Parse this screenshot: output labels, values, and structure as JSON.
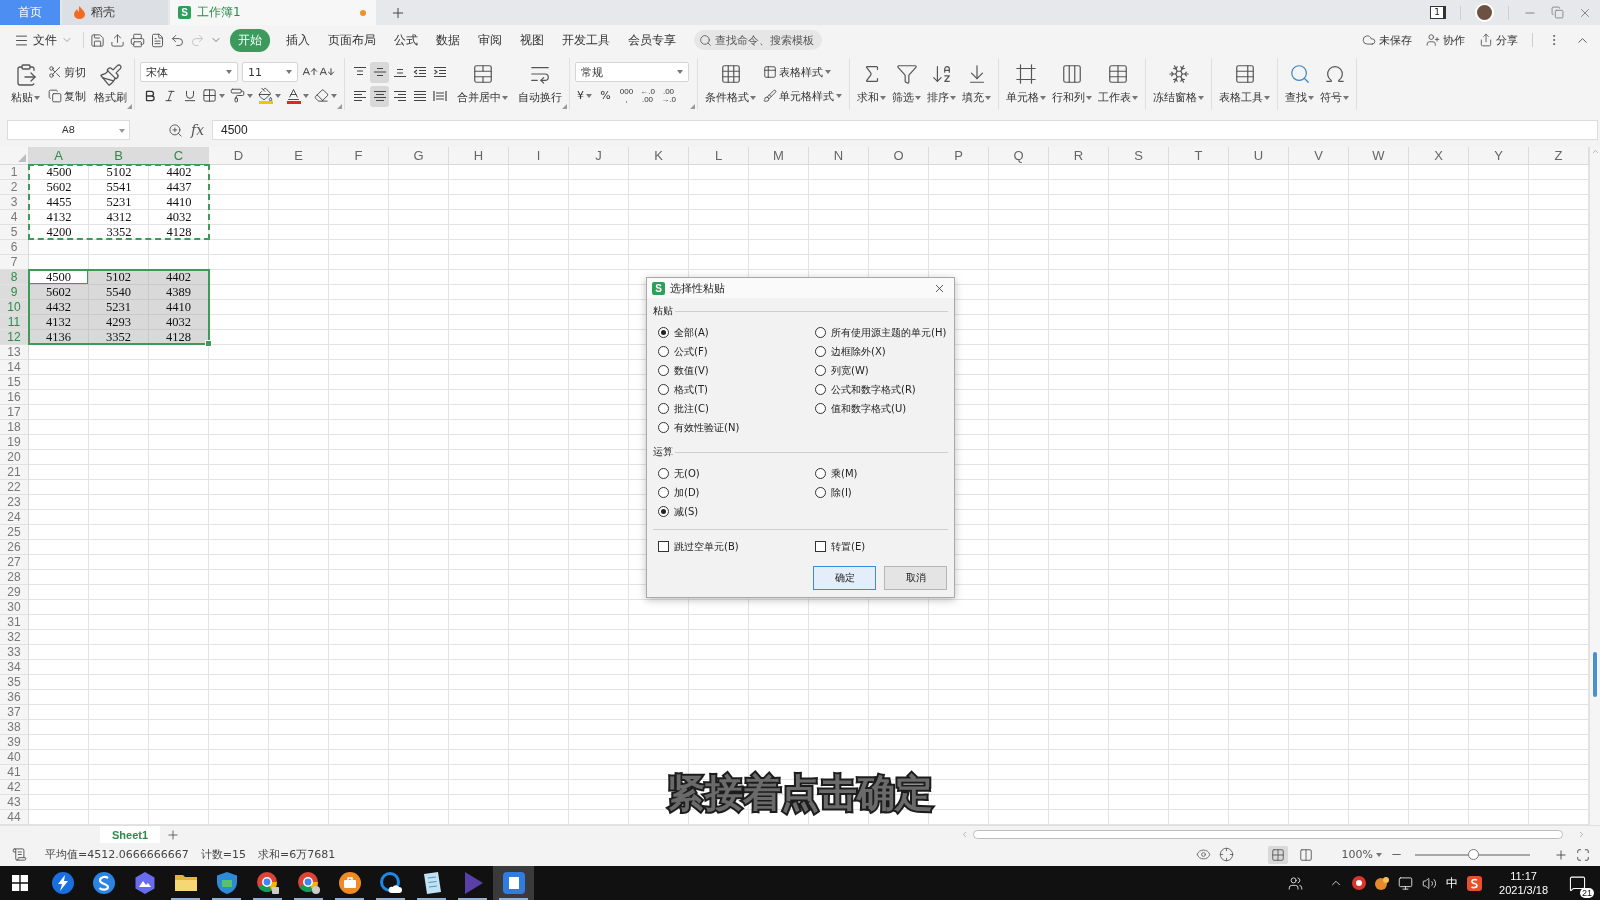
{
  "title_bar": {
    "tabs": [
      {
        "kind": "home",
        "label": "首页",
        "selected": false
      },
      {
        "kind": "docer",
        "label": "稻壳",
        "selected": false
      },
      {
        "kind": "workbook",
        "logo": "S",
        "label": "工作簿1",
        "selected": true,
        "unsaved": true
      }
    ],
    "window_count": "1"
  },
  "menu_bar": {
    "file": "文件",
    "quick_access": [
      {
        "kind": "save",
        "disabled": false
      },
      {
        "kind": "export",
        "disabled": false
      },
      {
        "kind": "print",
        "disabled": false
      },
      {
        "kind": "preview",
        "disabled": false
      },
      {
        "kind": "undo",
        "disabled": false
      },
      {
        "kind": "redo",
        "disabled": true
      },
      {
        "kind": "customize",
        "disabled": false
      }
    ],
    "tabs": [
      {
        "label": "开始",
        "selected": true
      },
      {
        "label": "插入",
        "selected": false
      },
      {
        "label": "页面布局",
        "selected": false
      },
      {
        "label": "公式",
        "selected": false
      },
      {
        "label": "数据",
        "selected": false
      },
      {
        "label": "审阅",
        "selected": false
      },
      {
        "label": "视图",
        "selected": false
      },
      {
        "label": "开发工具",
        "selected": false
      },
      {
        "label": "会员专享",
        "selected": false
      }
    ],
    "search": {
      "placeholder": "查找命令、搜索模板"
    },
    "actions": [
      {
        "kind": "cloud",
        "label": "未保存"
      },
      {
        "kind": "collaborate",
        "label": "协作"
      },
      {
        "kind": "share",
        "label": "分享"
      }
    ]
  },
  "ribbon": {
    "clipboard": {
      "paste": "粘贴",
      "cut": "剪切",
      "copy": "复制",
      "format_painter": "格式刷"
    },
    "font": {
      "name": "宋体",
      "size": "11"
    },
    "alignment": {
      "vertical": [
        {
          "kind": "top",
          "selected": false
        },
        {
          "kind": "middle",
          "selected": true
        },
        {
          "kind": "bottom",
          "selected": false
        }
      ],
      "horizontal": [
        {
          "kind": "left",
          "selected": false
        },
        {
          "kind": "center",
          "selected": true
        },
        {
          "kind": "right",
          "selected": false
        },
        {
          "kind": "justify",
          "selected": false
        },
        {
          "kind": "distributed",
          "selected": false
        }
      ],
      "merge": "合并居中",
      "wrap": "自动换行"
    },
    "number": {
      "format": "常规",
      "buttons": [
        {
          "kind": "currency",
          "lines": [
            "¥"
          ]
        },
        {
          "kind": "percent",
          "lines": [
            "%"
          ]
        },
        {
          "kind": "thousands",
          "lines": [
            "000",
            ","
          ]
        },
        {
          "kind": "add_decimal",
          "lines": [
            "←.0",
            ".00"
          ]
        },
        {
          "kind": "remove_decimal",
          "lines": [
            ".00",
            "→.0"
          ]
        }
      ]
    },
    "styles": {
      "conditional": "条件格式",
      "table_style": "表格样式",
      "cell_style": "单元格样式"
    },
    "tool_groups": [
      {
        "tools": [
          {
            "kind": "sum",
            "label": "求和"
          },
          {
            "kind": "filter",
            "label": "筛选"
          },
          {
            "kind": "sort",
            "label": "排序"
          },
          {
            "kind": "fill",
            "label": "填充"
          }
        ]
      },
      {
        "tools": [
          {
            "kind": "cell",
            "label": "单元格"
          },
          {
            "kind": "row_col",
            "label": "行和列"
          },
          {
            "kind": "worksheet",
            "label": "工作表"
          }
        ]
      },
      {
        "tools": [
          {
            "kind": "freeze",
            "label": "冻结窗格"
          }
        ]
      },
      {
        "tools": [
          {
            "kind": "table_tools",
            "label": "表格工具"
          }
        ]
      },
      {
        "tools": [
          {
            "kind": "find",
            "label": "查找"
          },
          {
            "kind": "symbol",
            "label": "符号"
          }
        ]
      }
    ]
  },
  "formula_bar": {
    "name_box": "A8",
    "fx": "fx",
    "formula": "4500"
  },
  "sheet": {
    "columns": [
      {
        "label": "A",
        "selected": true
      },
      {
        "label": "B",
        "selected": true
      },
      {
        "label": "C",
        "selected": true
      },
      {
        "label": "D",
        "selected": false
      },
      {
        "label": "E",
        "selected": false
      },
      {
        "label": "F",
        "selected": false
      },
      {
        "label": "G",
        "selected": false
      },
      {
        "label": "H",
        "selected": false
      },
      {
        "label": "I",
        "selected": false
      },
      {
        "label": "J",
        "selected": false
      },
      {
        "label": "K",
        "selected": false
      },
      {
        "label": "L",
        "selected": false
      },
      {
        "label": "M",
        "selected": false
      },
      {
        "label": "N",
        "selected": false
      },
      {
        "label": "O",
        "selected": false
      },
      {
        "label": "P",
        "selected": false
      },
      {
        "label": "Q",
        "selected": false
      },
      {
        "label": "R",
        "selected": false
      },
      {
        "label": "S",
        "selected": false
      },
      {
        "label": "T",
        "selected": false
      },
      {
        "label": "U",
        "selected": false
      },
      {
        "label": "V",
        "selected": false
      },
      {
        "label": "W",
        "selected": false
      },
      {
        "label": "X",
        "selected": false
      },
      {
        "label": "Y",
        "selected": false
      },
      {
        "label": "Z",
        "selected": false
      }
    ],
    "rows": [
      {
        "label": "1",
        "copied": true,
        "selected": false,
        "cells": [
          {
            "value": "4500",
            "active": false
          },
          {
            "value": "5102",
            "active": false
          },
          {
            "value": "4402",
            "active": false
          }
        ]
      },
      {
        "label": "2",
        "copied": true,
        "selected": false,
        "cells": [
          {
            "value": "5602",
            "active": false
          },
          {
            "value": "5541",
            "active": false
          },
          {
            "value": "4437",
            "active": false
          }
        ]
      },
      {
        "label": "3",
        "copied": true,
        "selected": false,
        "cells": [
          {
            "value": "4455",
            "active": false
          },
          {
            "value": "5231",
            "active": false
          },
          {
            "value": "4410",
            "active": false
          }
        ]
      },
      {
        "label": "4",
        "copied": true,
        "selected": false,
        "cells": [
          {
            "value": "4132",
            "active": false
          },
          {
            "value": "4312",
            "active": false
          },
          {
            "value": "4032",
            "active": false
          }
        ]
      },
      {
        "label": "5",
        "copied": true,
        "selected": false,
        "cells": [
          {
            "value": "4200",
            "active": false
          },
          {
            "value": "3352",
            "active": false
          },
          {
            "value": "4128",
            "active": false
          }
        ]
      },
      {
        "label": "6",
        "copied": false,
        "selected": false
      },
      {
        "label": "7",
        "copied": false,
        "selected": false
      },
      {
        "label": "8",
        "copied": false,
        "selected": true,
        "cells": [
          {
            "value": "4500",
            "active": true
          },
          {
            "value": "5102",
            "active": false
          },
          {
            "value": "4402",
            "active": false
          }
        ]
      },
      {
        "label": "9",
        "copied": false,
        "selected": true,
        "cells": [
          {
            "value": "5602",
            "active": false
          },
          {
            "value": "5540",
            "active": false
          },
          {
            "value": "4389",
            "active": false
          }
        ]
      },
      {
        "label": "10",
        "copied": false,
        "selected": true,
        "cells": [
          {
            "value": "4432",
            "active": false
          },
          {
            "value": "5231",
            "active": false
          },
          {
            "value": "4410",
            "active": false
          }
        ]
      },
      {
        "label": "11",
        "copied": false,
        "selected": true,
        "cells": [
          {
            "value": "4132",
            "active": false
          },
          {
            "value": "4293",
            "active": false
          },
          {
            "value": "4032",
            "active": false
          }
        ]
      },
      {
        "label": "12",
        "copied": false,
        "selected": true,
        "cells": [
          {
            "value": "4136",
            "active": false
          },
          {
            "value": "3352",
            "active": false
          },
          {
            "value": "4128",
            "active": false
          }
        ]
      },
      {
        "label": "13",
        "copied": false,
        "selected": false
      },
      {
        "label": "14",
        "copied": false,
        "selected": false
      },
      {
        "label": "15",
        "copied": false,
        "selected": false
      },
      {
        "label": "16",
        "copied": false,
        "selected": false
      },
      {
        "label": "17",
        "copied": false,
        "selected": false
      },
      {
        "label": "18",
        "copied": false,
        "selected": false
      },
      {
        "label": "19",
        "copied": false,
        "selected": false
      },
      {
        "label": "20",
        "copied": false,
        "selected": false
      },
      {
        "label": "21",
        "copied": false,
        "selected": false
      },
      {
        "label": "22",
        "copied": false,
        "selected": false
      },
      {
        "label": "23",
        "copied": false,
        "selected": false
      },
      {
        "label": "24",
        "copied": false,
        "selected": false
      },
      {
        "label": "25",
        "copied": false,
        "selected": false
      },
      {
        "label": "26",
        "copied": false,
        "selected": false
      },
      {
        "label": "27",
        "copied": false,
        "selected": false
      },
      {
        "label": "28",
        "copied": false,
        "selected": false
      },
      {
        "label": "29",
        "copied": false,
        "selected": false
      },
      {
        "label": "30",
        "copied": false,
        "selected": false
      },
      {
        "label": "31",
        "copied": false,
        "selected": false
      },
      {
        "label": "32",
        "copied": false,
        "selected": false
      },
      {
        "label": "33",
        "copied": false,
        "selected": false
      },
      {
        "label": "34",
        "copied": false,
        "selected": false
      },
      {
        "label": "35",
        "copied": false,
        "selected": false
      },
      {
        "label": "36",
        "copied": false,
        "selected": false
      },
      {
        "label": "37",
        "copied": false,
        "selected": false
      },
      {
        "label": "38",
        "copied": false,
        "selected": false
      },
      {
        "label": "39",
        "copied": false,
        "selected": false
      },
      {
        "label": "40",
        "copied": false,
        "selected": false
      },
      {
        "label": "41",
        "copied": false,
        "selected": false
      },
      {
        "label": "42",
        "copied": false,
        "selected": false
      },
      {
        "label": "43",
        "copied": false,
        "selected": false
      },
      {
        "label": "44",
        "copied": false,
        "selected": false
      }
    ]
  },
  "dialog": {
    "logo": "S",
    "title": "选择性粘贴",
    "sections": [
      {
        "title": "粘贴",
        "options": [
          {
            "label": "全部(A)",
            "selected": true
          },
          {
            "label": "所有使用源主题的单元(H)",
            "selected": false
          },
          {
            "label": "公式(F)",
            "selected": false
          },
          {
            "label": "边框除外(X)",
            "selected": false
          },
          {
            "label": "数值(V)",
            "selected": false
          },
          {
            "label": "列宽(W)",
            "selected": false
          },
          {
            "label": "格式(T)",
            "selected": false
          },
          {
            "label": "公式和数字格式(R)",
            "selected": false
          },
          {
            "label": "批注(C)",
            "selected": false
          },
          {
            "label": "值和数字格式(U)",
            "selected": false
          },
          {
            "label": "有效性验证(N)",
            "selected": false
          }
        ]
      },
      {
        "title": "运算",
        "options": [
          {
            "label": "无(O)",
            "selected": false
          },
          {
            "label": "乘(M)",
            "selected": false
          },
          {
            "label": "加(D)",
            "selected": false
          },
          {
            "label": "除(I)",
            "selected": false
          },
          {
            "label": "减(S)",
            "selected": true
          }
        ]
      }
    ],
    "checkboxes": [
      {
        "label": "跳过空单元(B)",
        "checked": false
      },
      {
        "label": "转置(E)",
        "checked": false
      }
    ],
    "buttons": [
      {
        "kind": "primary",
        "label": "确定"
      },
      {
        "kind": "secondary",
        "label": "取消"
      }
    ]
  },
  "caption": "紧接着点击确定",
  "sheet_tabs": [
    {
      "label": "Sheet1",
      "selected": true
    }
  ],
  "status_bar": {
    "stats": [
      "平均值=4512.0666666667",
      "计数=15",
      "求和=6万7681"
    ],
    "views": [
      {
        "kind": "normal",
        "selected": true
      },
      {
        "kind": "page",
        "selected": false
      }
    ],
    "zoom": "100%",
    "zoom_slider": {
      "level": 0.5
    }
  },
  "taskbar": {
    "apps": [
      {
        "kind": "lightning",
        "active": false,
        "running": false
      },
      {
        "kind": "swirl",
        "active": false,
        "running": false
      },
      {
        "kind": "hexagon",
        "active": false,
        "running": false
      },
      {
        "kind": "folder",
        "active": false,
        "running": true
      },
      {
        "kind": "shield",
        "active": false,
        "running": true
      },
      {
        "kind": "browser_lock",
        "active": false,
        "running": true
      },
      {
        "kind": "browser_user",
        "active": false,
        "running": true
      },
      {
        "kind": "briefcase",
        "active": false,
        "running": true
      },
      {
        "kind": "cloud",
        "active": false,
        "running": true
      },
      {
        "kind": "notepad",
        "active": false,
        "running": true
      },
      {
        "kind": "play",
        "active": false,
        "running": true
      },
      {
        "kind": "document",
        "active": true,
        "running": true
      }
    ],
    "tray": {
      "ime": "中",
      "time": "11:17",
      "date": "2021/3/18",
      "notifications": "21"
    }
  }
}
